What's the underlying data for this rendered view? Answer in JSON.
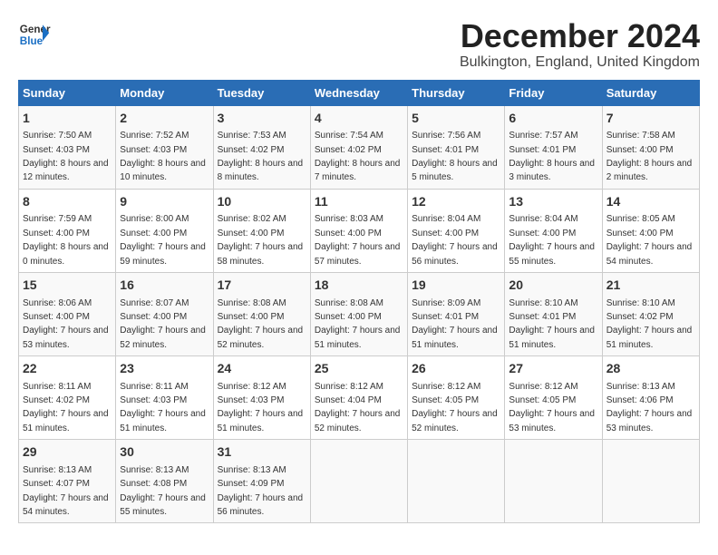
{
  "logo": {
    "line1": "General",
    "line2": "Blue"
  },
  "title": "December 2024",
  "location": "Bulkington, England, United Kingdom",
  "days_of_week": [
    "Sunday",
    "Monday",
    "Tuesday",
    "Wednesday",
    "Thursday",
    "Friday",
    "Saturday"
  ],
  "weeks": [
    [
      {
        "day": "1",
        "sunrise": "7:50 AM",
        "sunset": "4:03 PM",
        "daylight": "8 hours and 12 minutes."
      },
      {
        "day": "2",
        "sunrise": "7:52 AM",
        "sunset": "4:03 PM",
        "daylight": "8 hours and 10 minutes."
      },
      {
        "day": "3",
        "sunrise": "7:53 AM",
        "sunset": "4:02 PM",
        "daylight": "8 hours and 8 minutes."
      },
      {
        "day": "4",
        "sunrise": "7:54 AM",
        "sunset": "4:02 PM",
        "daylight": "8 hours and 7 minutes."
      },
      {
        "day": "5",
        "sunrise": "7:56 AM",
        "sunset": "4:01 PM",
        "daylight": "8 hours and 5 minutes."
      },
      {
        "day": "6",
        "sunrise": "7:57 AM",
        "sunset": "4:01 PM",
        "daylight": "8 hours and 3 minutes."
      },
      {
        "day": "7",
        "sunrise": "7:58 AM",
        "sunset": "4:00 PM",
        "daylight": "8 hours and 2 minutes."
      }
    ],
    [
      {
        "day": "8",
        "sunrise": "7:59 AM",
        "sunset": "4:00 PM",
        "daylight": "8 hours and 0 minutes."
      },
      {
        "day": "9",
        "sunrise": "8:00 AM",
        "sunset": "4:00 PM",
        "daylight": "7 hours and 59 minutes."
      },
      {
        "day": "10",
        "sunrise": "8:02 AM",
        "sunset": "4:00 PM",
        "daylight": "7 hours and 58 minutes."
      },
      {
        "day": "11",
        "sunrise": "8:03 AM",
        "sunset": "4:00 PM",
        "daylight": "7 hours and 57 minutes."
      },
      {
        "day": "12",
        "sunrise": "8:04 AM",
        "sunset": "4:00 PM",
        "daylight": "7 hours and 56 minutes."
      },
      {
        "day": "13",
        "sunrise": "8:04 AM",
        "sunset": "4:00 PM",
        "daylight": "7 hours and 55 minutes."
      },
      {
        "day": "14",
        "sunrise": "8:05 AM",
        "sunset": "4:00 PM",
        "daylight": "7 hours and 54 minutes."
      }
    ],
    [
      {
        "day": "15",
        "sunrise": "8:06 AM",
        "sunset": "4:00 PM",
        "daylight": "7 hours and 53 minutes."
      },
      {
        "day": "16",
        "sunrise": "8:07 AM",
        "sunset": "4:00 PM",
        "daylight": "7 hours and 52 minutes."
      },
      {
        "day": "17",
        "sunrise": "8:08 AM",
        "sunset": "4:00 PM",
        "daylight": "7 hours and 52 minutes."
      },
      {
        "day": "18",
        "sunrise": "8:08 AM",
        "sunset": "4:00 PM",
        "daylight": "7 hours and 51 minutes."
      },
      {
        "day": "19",
        "sunrise": "8:09 AM",
        "sunset": "4:01 PM",
        "daylight": "7 hours and 51 minutes."
      },
      {
        "day": "20",
        "sunrise": "8:10 AM",
        "sunset": "4:01 PM",
        "daylight": "7 hours and 51 minutes."
      },
      {
        "day": "21",
        "sunrise": "8:10 AM",
        "sunset": "4:02 PM",
        "daylight": "7 hours and 51 minutes."
      }
    ],
    [
      {
        "day": "22",
        "sunrise": "8:11 AM",
        "sunset": "4:02 PM",
        "daylight": "7 hours and 51 minutes."
      },
      {
        "day": "23",
        "sunrise": "8:11 AM",
        "sunset": "4:03 PM",
        "daylight": "7 hours and 51 minutes."
      },
      {
        "day": "24",
        "sunrise": "8:12 AM",
        "sunset": "4:03 PM",
        "daylight": "7 hours and 51 minutes."
      },
      {
        "day": "25",
        "sunrise": "8:12 AM",
        "sunset": "4:04 PM",
        "daylight": "7 hours and 52 minutes."
      },
      {
        "day": "26",
        "sunrise": "8:12 AM",
        "sunset": "4:05 PM",
        "daylight": "7 hours and 52 minutes."
      },
      {
        "day": "27",
        "sunrise": "8:12 AM",
        "sunset": "4:05 PM",
        "daylight": "7 hours and 53 minutes."
      },
      {
        "day": "28",
        "sunrise": "8:13 AM",
        "sunset": "4:06 PM",
        "daylight": "7 hours and 53 minutes."
      }
    ],
    [
      {
        "day": "29",
        "sunrise": "8:13 AM",
        "sunset": "4:07 PM",
        "daylight": "7 hours and 54 minutes."
      },
      {
        "day": "30",
        "sunrise": "8:13 AM",
        "sunset": "4:08 PM",
        "daylight": "7 hours and 55 minutes."
      },
      {
        "day": "31",
        "sunrise": "8:13 AM",
        "sunset": "4:09 PM",
        "daylight": "7 hours and 56 minutes."
      },
      null,
      null,
      null,
      null
    ]
  ],
  "labels": {
    "sunrise": "Sunrise:",
    "sunset": "Sunset:",
    "daylight": "Daylight:"
  }
}
